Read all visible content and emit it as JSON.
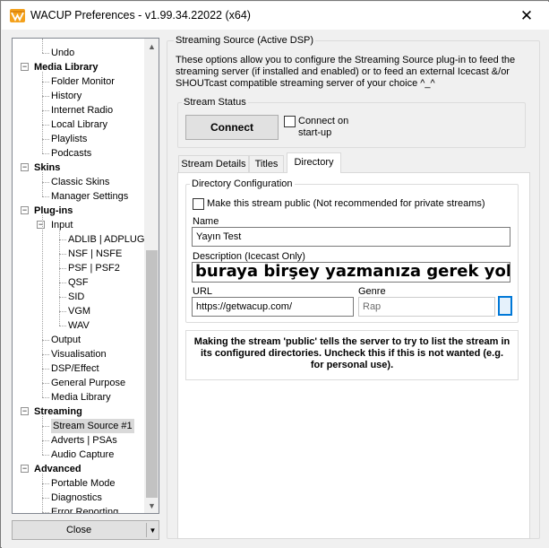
{
  "window": {
    "title": "WACUP Preferences - v1.99.34.22022 (x64)",
    "close_glyph": "✕",
    "icon": "wacup-logo-icon"
  },
  "tree": {
    "items": [
      {
        "label": "Undo",
        "level": 2,
        "bold": false
      },
      {
        "label": "Media Library",
        "level": 1,
        "bold": true,
        "expander": "−"
      },
      {
        "label": "Folder Monitor",
        "level": 2,
        "bold": false
      },
      {
        "label": "History",
        "level": 2,
        "bold": false
      },
      {
        "label": "Internet Radio",
        "level": 2,
        "bold": false
      },
      {
        "label": "Local Library",
        "level": 2,
        "bold": false
      },
      {
        "label": "Playlists",
        "level": 2,
        "bold": false
      },
      {
        "label": "Podcasts",
        "level": 2,
        "bold": false
      },
      {
        "label": "Skins",
        "level": 1,
        "bold": true,
        "expander": "−"
      },
      {
        "label": "Classic Skins",
        "level": 2,
        "bold": false
      },
      {
        "label": "Manager Settings",
        "level": 2,
        "bold": false
      },
      {
        "label": "Plug-ins",
        "level": 1,
        "bold": true,
        "expander": "−"
      },
      {
        "label": "Input",
        "level": 2,
        "bold": false,
        "expander": "−"
      },
      {
        "label": "ADLIB | ADPLUG",
        "level": 3,
        "bold": false
      },
      {
        "label": "NSF | NSFE",
        "level": 3,
        "bold": false
      },
      {
        "label": "PSF | PSF2",
        "level": 3,
        "bold": false
      },
      {
        "label": "QSF",
        "level": 3,
        "bold": false
      },
      {
        "label": "SID",
        "level": 3,
        "bold": false
      },
      {
        "label": "VGM",
        "level": 3,
        "bold": false
      },
      {
        "label": "WAV",
        "level": 3,
        "bold": false
      },
      {
        "label": "Output",
        "level": 2,
        "bold": false
      },
      {
        "label": "Visualisation",
        "level": 2,
        "bold": false
      },
      {
        "label": "DSP/Effect",
        "level": 2,
        "bold": false
      },
      {
        "label": "General Purpose",
        "level": 2,
        "bold": false
      },
      {
        "label": "Media Library",
        "level": 2,
        "bold": false
      },
      {
        "label": "Streaming",
        "level": 1,
        "bold": true,
        "expander": "−"
      },
      {
        "label": "Stream Source #1",
        "level": 2,
        "bold": false,
        "selected": true
      },
      {
        "label": "Adverts | PSAs",
        "level": 2,
        "bold": false
      },
      {
        "label": "Audio Capture",
        "level": 2,
        "bold": false
      },
      {
        "label": "Advanced",
        "level": 1,
        "bold": true,
        "expander": "−"
      },
      {
        "label": "Portable Mode",
        "level": 2,
        "bold": false
      },
      {
        "label": "Diagnostics",
        "level": 2,
        "bold": false
      },
      {
        "label": "Error Reporting",
        "level": 2,
        "bold": false
      }
    ],
    "scroll_up": "▲",
    "scroll_down": "▼"
  },
  "close_button": {
    "label": "Close",
    "dropdown_glyph": "▼"
  },
  "streaming_source": {
    "group_title": "Streaming Source (Active DSP)",
    "description": "These options allow you to configure the Streaming Source plug-in to feed the streaming server (if installed and enabled) or to feed an external Icecast &/or SHOUTcast compatible streaming server of your choice ^_^",
    "status_group_title": "Stream Status",
    "connect_label": "Connect",
    "connect_on_startup_label": "Connect on start-up",
    "connect_on_startup_checked": false
  },
  "tabs": [
    {
      "label": "Stream Details",
      "active": false
    },
    {
      "label": "Titles",
      "active": false
    },
    {
      "label": "Directory",
      "active": true
    }
  ],
  "directory": {
    "group_title": "Directory Configuration",
    "public_label": "Make this stream public (Not recommended for private streams)",
    "public_checked": false,
    "name_label": "Name",
    "name_value": "Yayın Test",
    "description_label": "Description (Icecast Only)",
    "description_value": "buraya birşey yazmanıza gerek yok.",
    "url_label": "URL",
    "url_value": "https://getwacup.com/",
    "genre_label": "Genre",
    "genre_value": "Rap",
    "notice": "Making the stream 'public' tells the server to try to list the stream in its configured directories. Uncheck this if this is not wanted (e.g. for personal use)."
  }
}
